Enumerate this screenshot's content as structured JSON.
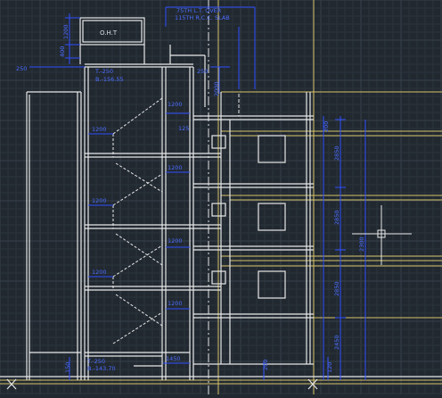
{
  "viewport": {
    "name": "Drawing area"
  },
  "colors": {
    "background": "#212830",
    "grid_minor": "#2b333c",
    "grid_major": "#36404a",
    "wall": "#e8e8e8",
    "dimension": "#2f4fff",
    "dim_text": "#4a6cff",
    "yellow": "#d8c46a",
    "white_text": "#d8dde4"
  },
  "labels": {
    "oht": "O.H.T",
    "top_note_1": "75TH L.T. OVER",
    "top_note_2": "115TH R.C.C. SLAB",
    "top_level_t": "T.-250",
    "top_level_b": "B.-156.55",
    "bottom_level_t": "T.-250",
    "bottom_level_b": "B.-143.70"
  },
  "dimensions": {
    "oht_height": "1200",
    "oht_base": "400",
    "parapet": "250",
    "top_250": "250",
    "top_2000": "2000",
    "landing": "1200",
    "width_125": "125",
    "bottom_1450": "1450",
    "bottom_150": "150",
    "bottom_200": "200",
    "bottom_120": "120",
    "floor_200": "200",
    "floor_2850": "2850",
    "floor_2450": "2450",
    "floor_2300": "2300"
  }
}
